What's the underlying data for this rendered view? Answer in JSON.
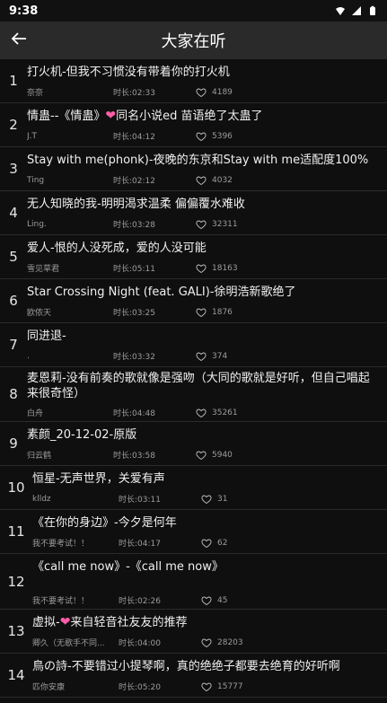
{
  "status": {
    "time": "9:38"
  },
  "header": {
    "title": "大家在听"
  },
  "list": {
    "items": [
      {
        "index": "1",
        "title": "打火机-但我不习惯没有带着你的打火机",
        "uploader": "奈奈",
        "duration": "时长:02:33",
        "likes": "4189"
      },
      {
        "index": "2",
        "title_pre": "情蛊--《情蛊》",
        "heart": "❤",
        "title_post": "同名小说ed 苗语绝了太蛊了",
        "uploader": "J.T",
        "duration": "时长:04:12",
        "likes": "5396"
      },
      {
        "index": "3",
        "title": "Stay with me(phonk)-夜晚的东京和Stay with me适配度100%",
        "uploader": "Ting",
        "duration": "时长:02:12",
        "likes": "4032"
      },
      {
        "index": "4",
        "title": "无人知晓的我-明明渴求温柔 偏偏覆水难收",
        "uploader": "Ling.",
        "duration": "时长:03:28",
        "likes": "32311"
      },
      {
        "index": "5",
        "title": "爱人-恨的人没死成，爱的人没可能",
        "uploader": "雪见草君",
        "duration": "时长:05:11",
        "likes": "18163"
      },
      {
        "index": "6",
        "title": "Star Crossing Night (feat. GALI)-徐明浩新歌绝了",
        "uploader": "欧侬天",
        "duration": "时长:03:25",
        "likes": "1876"
      },
      {
        "index": "7",
        "title": "同进退-",
        "uploader": ".",
        "duration": "时长:03:32",
        "likes": "374"
      },
      {
        "index": "8",
        "title": "麦恩莉-没有前奏的歌就像是强吻（大同的歌就是好听，但自己唱起来很奇怪）",
        "uploader": "白舟",
        "duration": "时长:04:48",
        "likes": "35261"
      },
      {
        "index": "9",
        "title": "素颜_20-12-02-原版",
        "uploader": "归云鹤",
        "duration": "时长:03:58",
        "likes": "5940"
      },
      {
        "index": "10",
        "title": "恒星-无声世界，关爱有声",
        "uploader": "klldz",
        "duration": "时长:03:11",
        "likes": "31"
      },
      {
        "index": "11",
        "title": "《在你的身边》-今夕是何年",
        "uploader": "我不要考试！！",
        "duration": "时长:04:17",
        "likes": "62"
      },
      {
        "index": "12",
        "title": "《call me now》-《call me now》",
        "uploader": "我不要考试！！",
        "duration": "时长:02:26",
        "likes": "45"
      },
      {
        "index": "13",
        "title_pre": "虚拟-",
        "heart": "❤",
        "title_post": "来自轻音社友友的推荐",
        "uploader": "卿久（无歌手不同...",
        "duration": "时长:04:00",
        "likes": "28203"
      },
      {
        "index": "14",
        "title": "鳥の詩-不要错过小提琴啊，真的绝绝子都要去绝育的好听啊",
        "uploader": "匹你安康",
        "duration": "时长:05:20",
        "likes": "15777"
      }
    ]
  },
  "colors": {
    "heart": "#ff5ca8",
    "appbar": "#2a2a2a",
    "bg": "#0f0f0f"
  }
}
